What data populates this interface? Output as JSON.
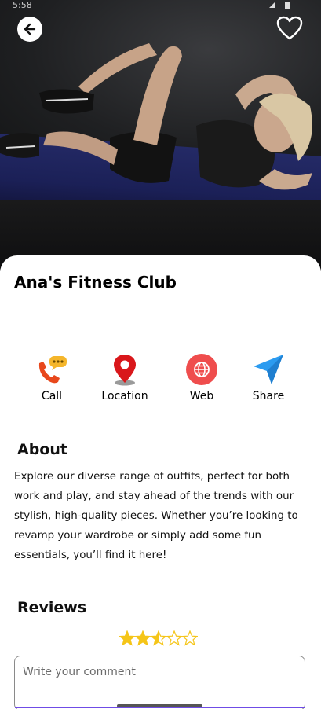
{
  "status_bar": {
    "time": "5:58"
  },
  "header": {
    "back_icon": "arrow-left-icon",
    "favorite_icon": "heart-outline-icon"
  },
  "title": "Ana's Fitness Club",
  "actions": [
    {
      "label": "Call",
      "icon": "phone-chat-icon"
    },
    {
      "label": "Location",
      "icon": "map-pin-icon"
    },
    {
      "label": "Web",
      "icon": "globe-icon"
    },
    {
      "label": "Share",
      "icon": "send-icon"
    }
  ],
  "about": {
    "heading": "About",
    "text": "Explore our diverse range of outfits, perfect for both work and play, and stay ahead of the trends with our stylish, high-quality pieces. Whether you’re looking to revamp your wardrobe or simply add some fun essentials, you’ll find it here!"
  },
  "reviews": {
    "heading": "Reviews",
    "rating": 2.5,
    "max_rating": 5,
    "comment_placeholder": "Write your comment"
  },
  "colors": {
    "star": "#f5c518",
    "accent": "#6f4ce6",
    "call_icon": "#e8481c",
    "location_icon": "#d9171b",
    "web_icon": "#ef4d4d",
    "share_icon": "#2b9bf0"
  }
}
